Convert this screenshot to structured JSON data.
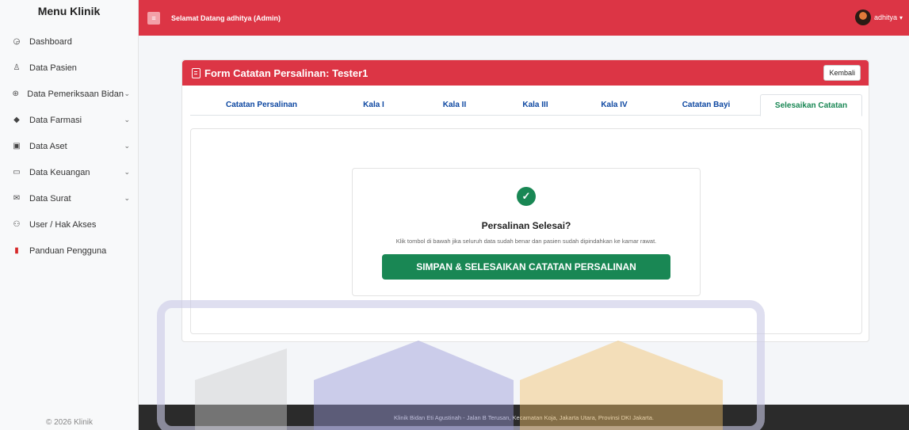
{
  "sidebar": {
    "title": "Menu Klinik",
    "items": [
      {
        "label": "Dashboard",
        "icon": "dashboard-icon",
        "glyph": "◶",
        "has_submenu": false
      },
      {
        "label": "Data Pasien",
        "icon": "user-icon",
        "glyph": "♙",
        "has_submenu": false
      },
      {
        "label": "Data Pemeriksaan Bidan",
        "icon": "stethoscope-icon",
        "glyph": "⊛",
        "has_submenu": true
      },
      {
        "label": "Data Farmasi",
        "icon": "pill-icon",
        "glyph": "◆",
        "has_submenu": true
      },
      {
        "label": "Data Aset",
        "icon": "box-icon",
        "glyph": "▣",
        "has_submenu": true
      },
      {
        "label": "Data Keuangan",
        "icon": "wallet-icon",
        "glyph": "▭",
        "has_submenu": true
      },
      {
        "label": "Data Surat",
        "icon": "envelope-icon",
        "glyph": "✉",
        "has_submenu": true
      },
      {
        "label": "User / Hak Akses",
        "icon": "users-icon",
        "glyph": "⚇",
        "has_submenu": false
      },
      {
        "label": "Panduan Pengguna",
        "icon": "pdf-icon",
        "glyph": "▮",
        "has_submenu": false
      }
    ],
    "footer": "© 2026 Klinik"
  },
  "topbar": {
    "welcome": "Selamat Datang adhitya (Admin)",
    "username": "adhitya"
  },
  "card": {
    "title": "Form Catatan Persalinan: Tester1",
    "back_label": "Kembali",
    "tabs": [
      {
        "label": "Catatan Persalinan",
        "active": false
      },
      {
        "label": "Kala I",
        "active": false
      },
      {
        "label": "Kala II",
        "active": false
      },
      {
        "label": "Kala III",
        "active": false
      },
      {
        "label": "Kala IV",
        "active": false
      },
      {
        "label": "Catatan Bayi",
        "active": false
      },
      {
        "label": "Selesaikan Catatan",
        "active": true
      }
    ],
    "confirm": {
      "title": "Persalinan Selesai?",
      "text": "Klik tombol di bawah jika seluruh data sudah benar dan pasien sudah dipindahkan ke kamar rawat.",
      "button_label": "SIMPAN & SELESAIKAN CATATAN PERSALINAN"
    }
  },
  "footer": {
    "text": "Klinik Bidan Eti Agustinah - Jalan B Terusan, Kecamatan Koja, Jakarta Utara, Provinsi DKI Jakarta."
  },
  "colors": {
    "primary": "#dc3545",
    "success": "#198754",
    "tab_text": "#0d47a1",
    "footer_bg": "#2b2b2b"
  }
}
